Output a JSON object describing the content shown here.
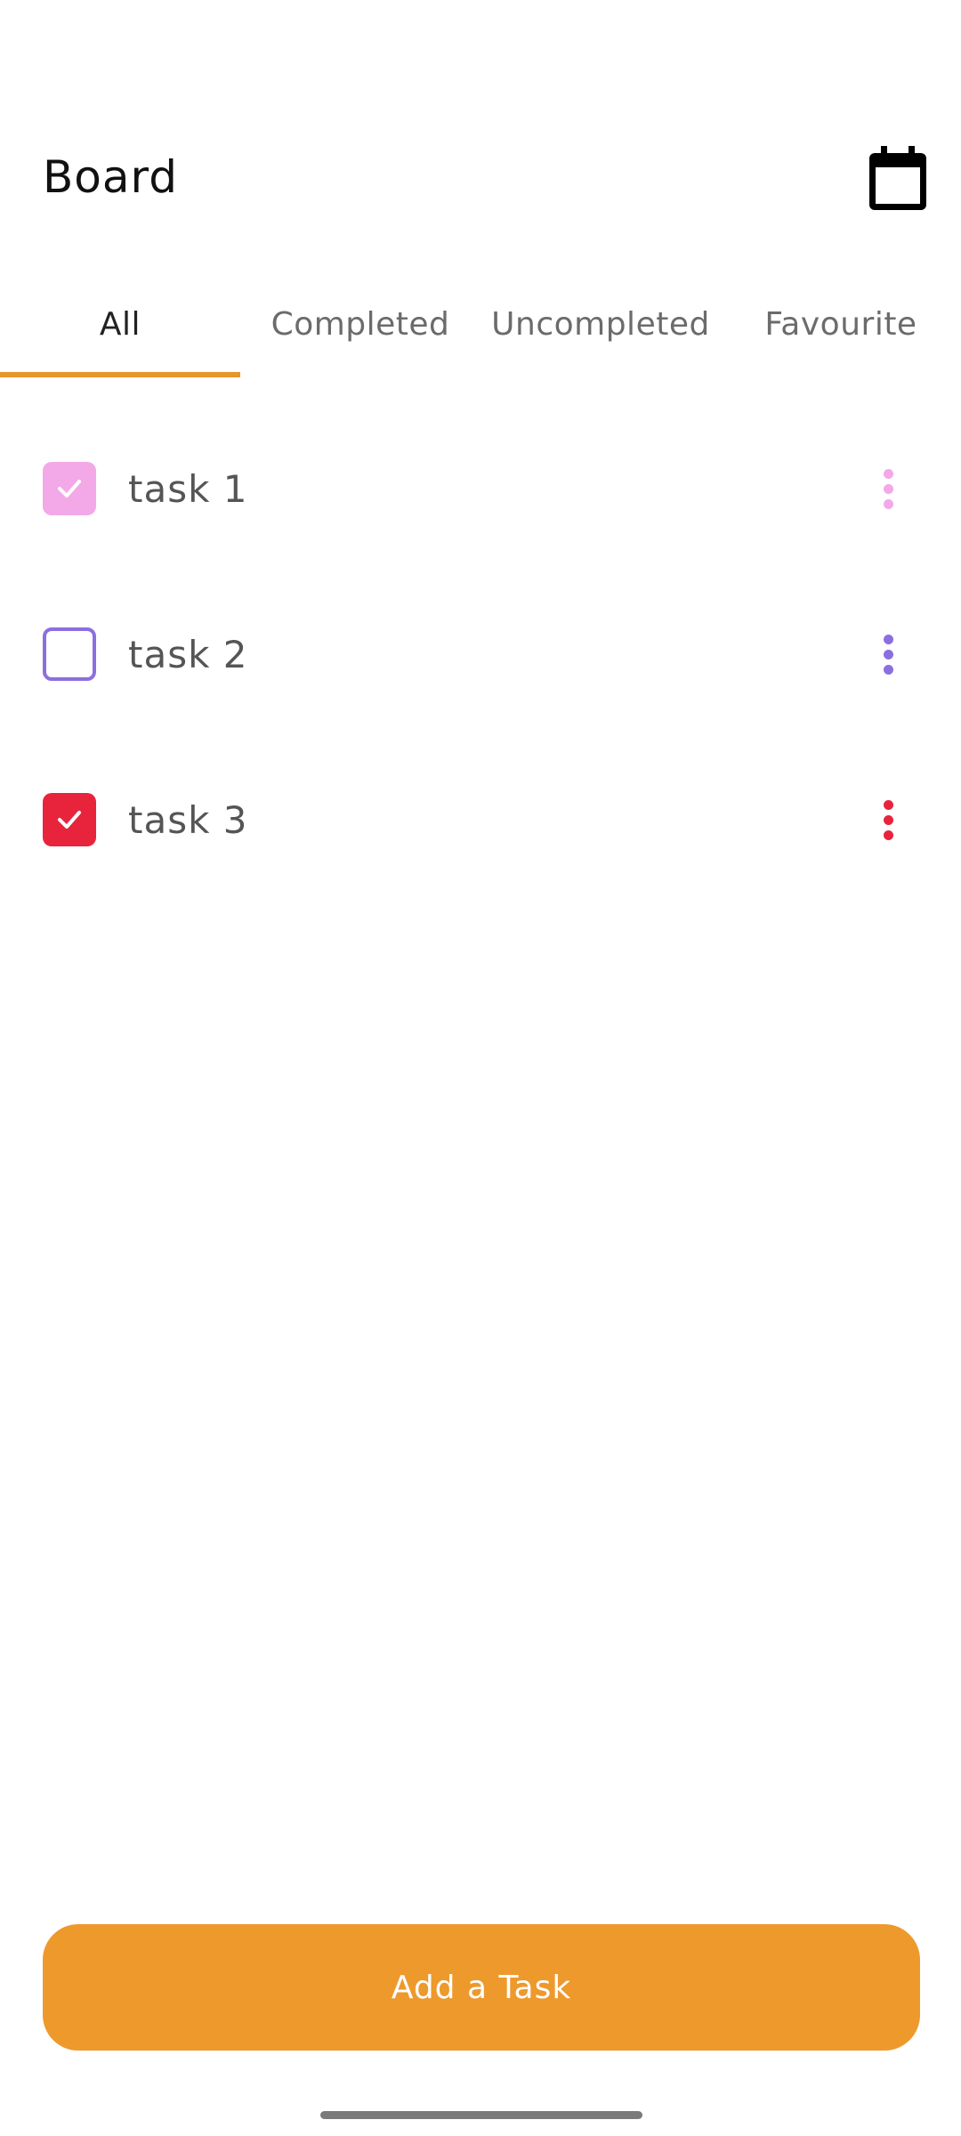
{
  "header": {
    "title": "Board",
    "calendar_icon": "calendar-icon"
  },
  "tabs": [
    {
      "label": "All",
      "active": true
    },
    {
      "label": "Completed",
      "active": false
    },
    {
      "label": "Uncompleted",
      "active": false
    },
    {
      "label": "Favourite",
      "active": false
    }
  ],
  "colors": {
    "accent": "#ee992c",
    "tab_indicator": "#e8962c",
    "task1": "#f3a8e8",
    "task2": "#8b6fe0",
    "task3": "#e8243c"
  },
  "tasks": [
    {
      "label": "task 1",
      "checked": true,
      "color": "#f3a8e8",
      "menu_icon": "more-vertical-icon"
    },
    {
      "label": "task 2",
      "checked": false,
      "color": "#8b6fe0",
      "menu_icon": "more-vertical-icon"
    },
    {
      "label": "task 3",
      "checked": true,
      "color": "#e8243c",
      "menu_icon": "more-vertical-icon"
    }
  ],
  "footer": {
    "add_button_label": "Add a Task"
  }
}
